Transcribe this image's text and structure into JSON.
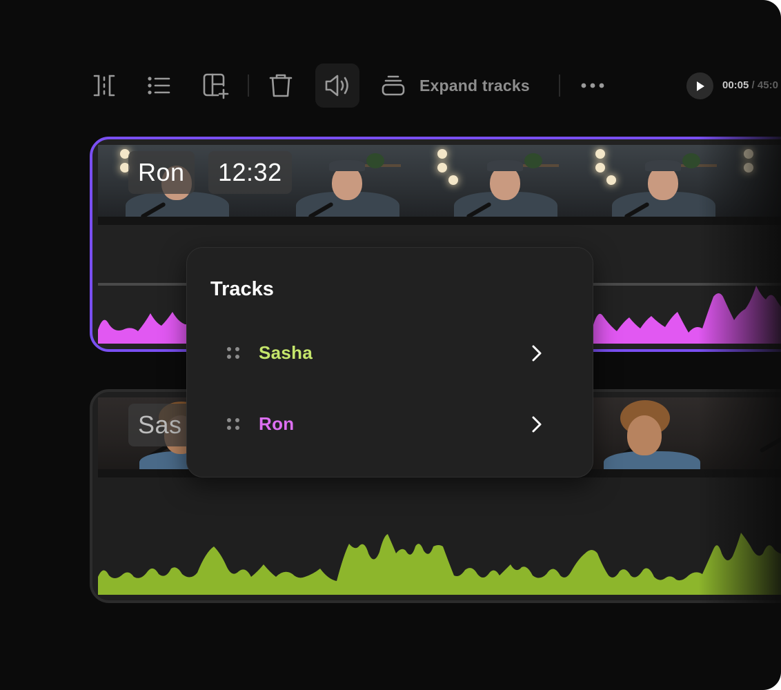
{
  "colors": {
    "ron": "#e158f2",
    "sasha": "#8db62c",
    "sasha_label": "#c5e66b",
    "ron_label": "#dd6ff2",
    "selected_outline": "#7a4ff2"
  },
  "toolbar": {
    "icons": [
      "split-icon",
      "list-icon",
      "add-layout-icon",
      "trash-icon",
      "volume-icon",
      "layers-icon",
      "more-icon"
    ],
    "expand_label": "Expand tracks",
    "time_current": "00:05",
    "time_separator": "/",
    "time_total": "45:0"
  },
  "tracks": [
    {
      "id": "ron",
      "name": "Ron",
      "duration": "12:32",
      "selected": true
    },
    {
      "id": "sasha",
      "name": "Sas",
      "selected": false
    }
  ],
  "tracks_popup": {
    "title": "Tracks",
    "items": [
      {
        "label": "Sasha",
        "color": "#c5e66b"
      },
      {
        "label": "Ron",
        "color": "#dd6ff2"
      }
    ]
  }
}
